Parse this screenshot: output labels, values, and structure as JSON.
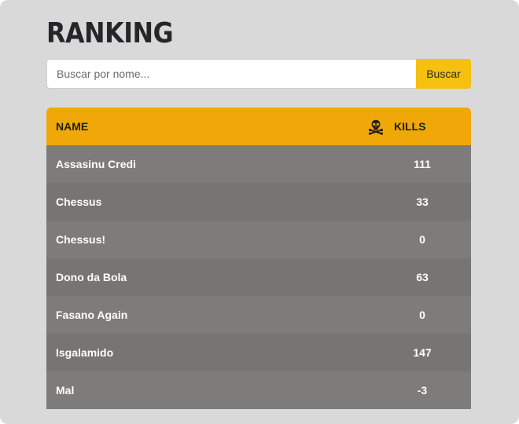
{
  "page": {
    "title": "RANKING"
  },
  "search": {
    "placeholder": "Buscar por nome...",
    "value": "",
    "button_label": "Buscar"
  },
  "table": {
    "headers": {
      "name": "NAME",
      "kills": "KILLS",
      "kills_icon": "skull-crossbones-icon"
    },
    "rows": [
      {
        "name": "Assasinu Credi",
        "kills": "111"
      },
      {
        "name": "Chessus",
        "kills": "33"
      },
      {
        "name": "Chessus!",
        "kills": "0"
      },
      {
        "name": "Dono da Bola",
        "kills": "63"
      },
      {
        "name": "Fasano Again",
        "kills": "0"
      },
      {
        "name": "Isgalamido",
        "kills": "147"
      },
      {
        "name": "Mal",
        "kills": "-3"
      }
    ]
  },
  "colors": {
    "panel_background": "#d9d9d9",
    "header_accent": "#f0a808",
    "button_accent": "#f5c00f",
    "row_odd": "#7d7c7a",
    "row_even": "#767573"
  }
}
